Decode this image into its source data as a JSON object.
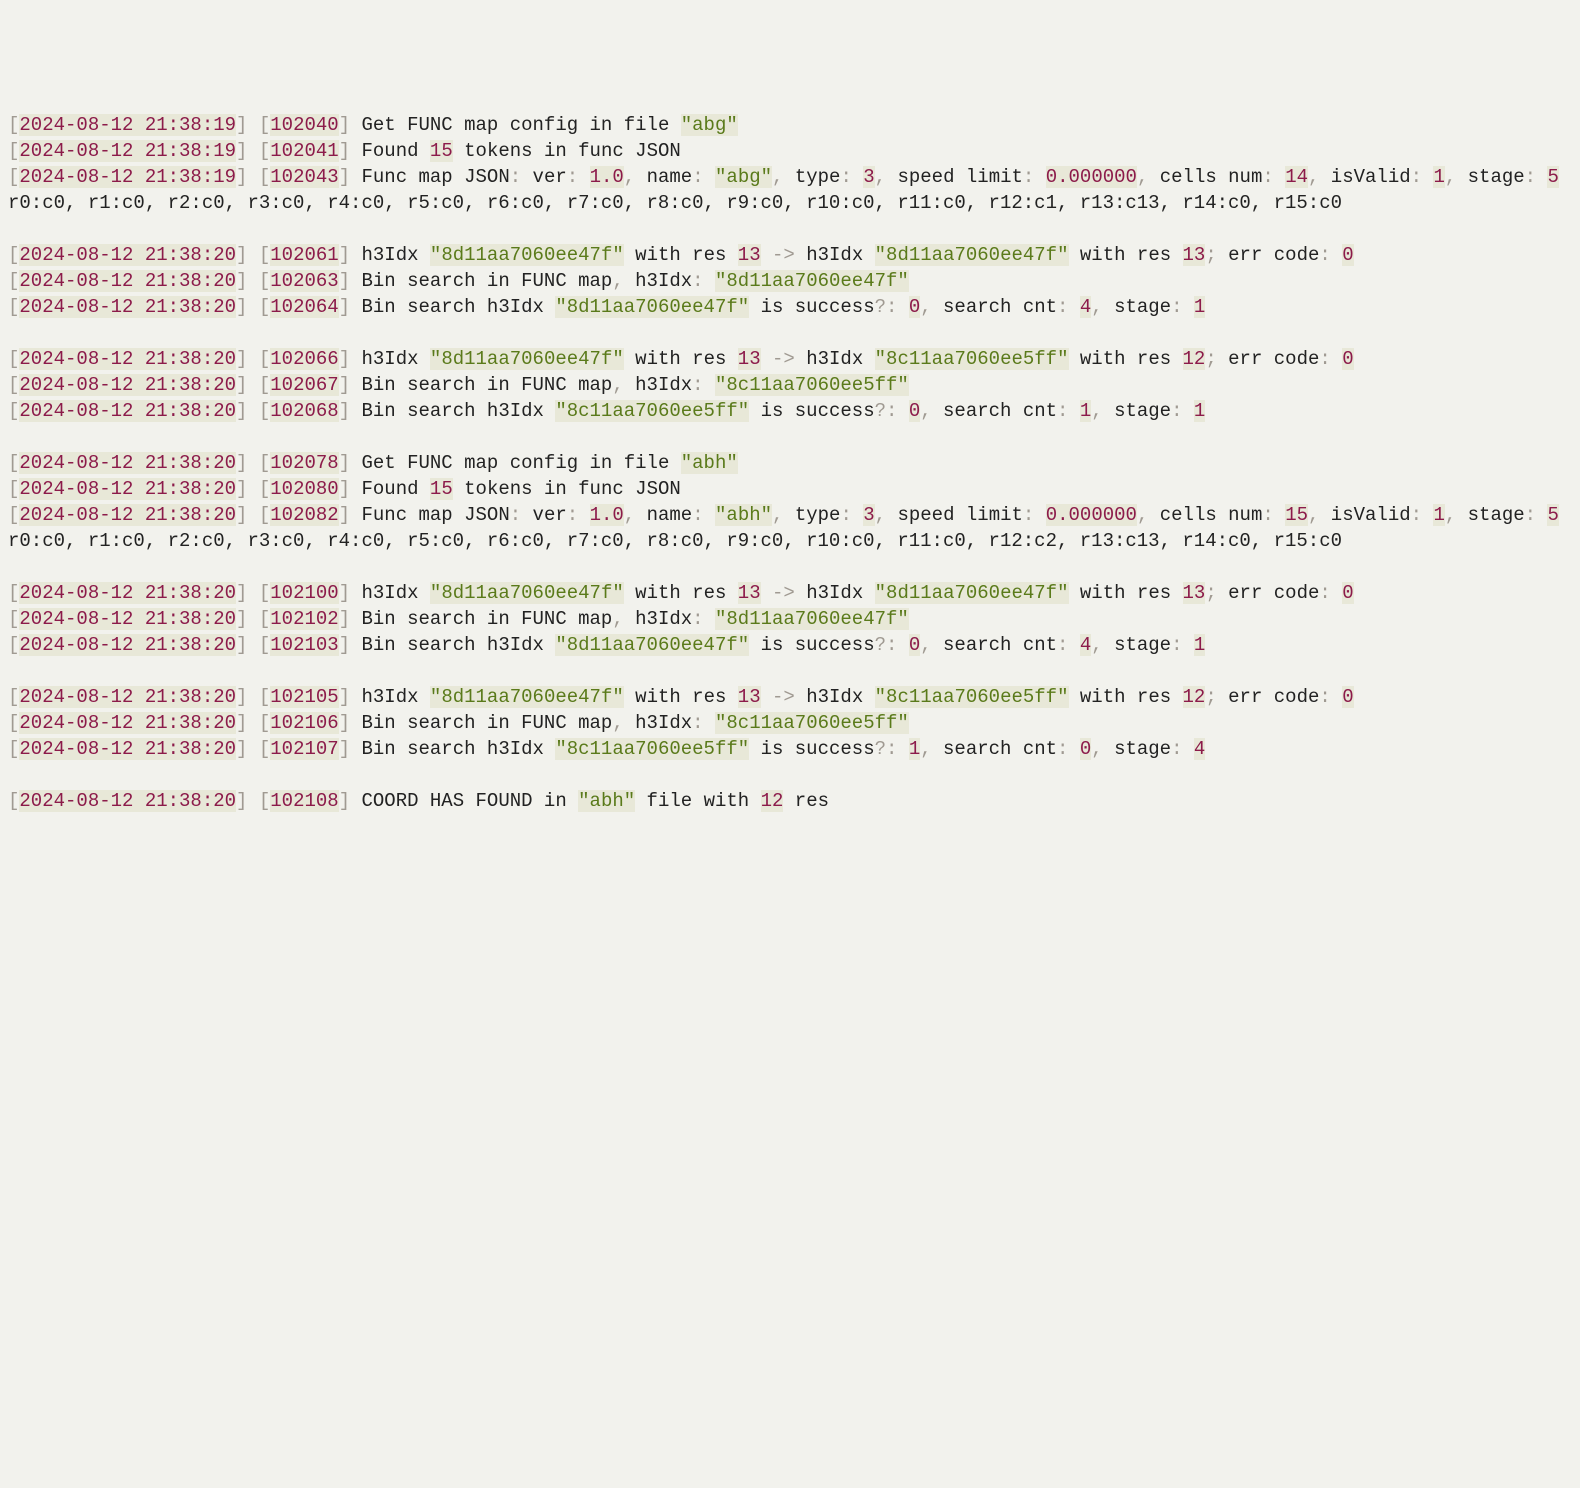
{
  "lines": [
    {
      "kind": "log",
      "ts": "2024-08-12 21:38:19",
      "id": "102040",
      "segs": [
        {
          "t": " Get FUNC map config in file "
        },
        {
          "t": "\"abg\"",
          "cls": "str hi"
        }
      ]
    },
    {
      "kind": "log",
      "ts": "2024-08-12 21:38:19",
      "id": "102041",
      "segs": [
        {
          "t": " Found "
        },
        {
          "t": "15",
          "cls": "num hi"
        },
        {
          "t": " tokens in func JSON"
        }
      ]
    },
    {
      "kind": "log",
      "ts": "2024-08-12 21:38:19",
      "id": "102043",
      "segs": [
        {
          "t": " Func map JSON"
        },
        {
          "t": ":",
          "cls": "punct"
        },
        {
          "t": " ver"
        },
        {
          "t": ":",
          "cls": "punct"
        },
        {
          "t": " "
        },
        {
          "t": "1.0",
          "cls": "num hi"
        },
        {
          "t": ",",
          "cls": "punct"
        },
        {
          "t": " name"
        },
        {
          "t": ":",
          "cls": "punct"
        },
        {
          "t": " "
        },
        {
          "t": "\"abg\"",
          "cls": "str hi"
        },
        {
          "t": ",",
          "cls": "punct"
        },
        {
          "t": " type"
        },
        {
          "t": ":",
          "cls": "punct"
        },
        {
          "t": " "
        },
        {
          "t": "3",
          "cls": "num hi"
        },
        {
          "t": ",",
          "cls": "punct"
        },
        {
          "t": " speed limit"
        },
        {
          "t": ":",
          "cls": "punct"
        },
        {
          "t": " "
        },
        {
          "t": "0.000000",
          "cls": "num hi"
        },
        {
          "t": ",",
          "cls": "punct"
        },
        {
          "t": " cells num"
        },
        {
          "t": ":",
          "cls": "punct"
        },
        {
          "t": " "
        },
        {
          "t": "14",
          "cls": "num hi"
        },
        {
          "t": ",",
          "cls": "punct"
        },
        {
          "t": " isValid"
        },
        {
          "t": ":",
          "cls": "punct"
        },
        {
          "t": " "
        },
        {
          "t": "1",
          "cls": "num hi"
        },
        {
          "t": ",",
          "cls": "punct"
        },
        {
          "t": " stage"
        },
        {
          "t": ":",
          "cls": "punct"
        },
        {
          "t": " "
        },
        {
          "t": "5",
          "cls": "num hi"
        }
      ]
    },
    {
      "kind": "plain",
      "text": "r0:c0, r1:c0, r2:c0, r3:c0, r4:c0, r5:c0, r6:c0, r7:c0, r8:c0, r9:c0, r10:c0, r11:c0, r12:c1, r13:c13, r14:c0, r15:c0"
    },
    {
      "kind": "blank"
    },
    {
      "kind": "log",
      "ts": "2024-08-12 21:38:20",
      "id": "102061",
      "segs": [
        {
          "t": " h3Idx "
        },
        {
          "t": "\"8d11aa7060ee47f\"",
          "cls": "str hi"
        },
        {
          "t": " with res "
        },
        {
          "t": "13",
          "cls": "num hi"
        },
        {
          "t": " "
        },
        {
          "t": "->",
          "cls": "arrow"
        },
        {
          "t": " h3Idx "
        },
        {
          "t": "\"8d11aa7060ee47f\"",
          "cls": "str hi"
        },
        {
          "t": " with res "
        },
        {
          "t": "13",
          "cls": "num hi"
        },
        {
          "t": ";",
          "cls": "punct"
        },
        {
          "t": " err code"
        },
        {
          "t": ":",
          "cls": "punct"
        },
        {
          "t": " "
        },
        {
          "t": "0",
          "cls": "num hi"
        }
      ]
    },
    {
      "kind": "log",
      "ts": "2024-08-12 21:38:20",
      "id": "102063",
      "segs": [
        {
          "t": " Bin search in FUNC map"
        },
        {
          "t": ",",
          "cls": "punct"
        },
        {
          "t": " h3Idx"
        },
        {
          "t": ":",
          "cls": "punct"
        },
        {
          "t": " "
        },
        {
          "t": "\"8d11aa7060ee47f\"",
          "cls": "str hi"
        }
      ]
    },
    {
      "kind": "log",
      "ts": "2024-08-12 21:38:20",
      "id": "102064",
      "segs": [
        {
          "t": " Bin search h3Idx "
        },
        {
          "t": "\"8d11aa7060ee47f\"",
          "cls": "str hi"
        },
        {
          "t": " is success"
        },
        {
          "t": "?:",
          "cls": "punct"
        },
        {
          "t": " "
        },
        {
          "t": "0",
          "cls": "num hi"
        },
        {
          "t": ",",
          "cls": "punct"
        },
        {
          "t": " search cnt"
        },
        {
          "t": ":",
          "cls": "punct"
        },
        {
          "t": " "
        },
        {
          "t": "4",
          "cls": "num hi"
        },
        {
          "t": ",",
          "cls": "punct"
        },
        {
          "t": " stage"
        },
        {
          "t": ":",
          "cls": "punct"
        },
        {
          "t": " "
        },
        {
          "t": "1",
          "cls": "num hi"
        }
      ]
    },
    {
      "kind": "blank"
    },
    {
      "kind": "log",
      "ts": "2024-08-12 21:38:20",
      "id": "102066",
      "segs": [
        {
          "t": " h3Idx "
        },
        {
          "t": "\"8d11aa7060ee47f\"",
          "cls": "str hi"
        },
        {
          "t": " with res "
        },
        {
          "t": "13",
          "cls": "num hi"
        },
        {
          "t": " "
        },
        {
          "t": "->",
          "cls": "arrow"
        },
        {
          "t": " h3Idx "
        },
        {
          "t": "\"8c11aa7060ee5ff\"",
          "cls": "str hi"
        },
        {
          "t": " with res "
        },
        {
          "t": "12",
          "cls": "num hi"
        },
        {
          "t": ";",
          "cls": "punct"
        },
        {
          "t": " err code"
        },
        {
          "t": ":",
          "cls": "punct"
        },
        {
          "t": " "
        },
        {
          "t": "0",
          "cls": "num hi"
        }
      ]
    },
    {
      "kind": "log",
      "ts": "2024-08-12 21:38:20",
      "id": "102067",
      "segs": [
        {
          "t": " Bin search in FUNC map"
        },
        {
          "t": ",",
          "cls": "punct"
        },
        {
          "t": " h3Idx"
        },
        {
          "t": ":",
          "cls": "punct"
        },
        {
          "t": " "
        },
        {
          "t": "\"8c11aa7060ee5ff\"",
          "cls": "str hi"
        }
      ]
    },
    {
      "kind": "log",
      "ts": "2024-08-12 21:38:20",
      "id": "102068",
      "segs": [
        {
          "t": " Bin search h3Idx "
        },
        {
          "t": "\"8c11aa7060ee5ff\"",
          "cls": "str hi"
        },
        {
          "t": " is success"
        },
        {
          "t": "?:",
          "cls": "punct"
        },
        {
          "t": " "
        },
        {
          "t": "0",
          "cls": "num hi"
        },
        {
          "t": ",",
          "cls": "punct"
        },
        {
          "t": " search cnt"
        },
        {
          "t": ":",
          "cls": "punct"
        },
        {
          "t": " "
        },
        {
          "t": "1",
          "cls": "num hi"
        },
        {
          "t": ",",
          "cls": "punct"
        },
        {
          "t": " stage"
        },
        {
          "t": ":",
          "cls": "punct"
        },
        {
          "t": " "
        },
        {
          "t": "1",
          "cls": "num hi"
        }
      ]
    },
    {
      "kind": "blank"
    },
    {
      "kind": "log",
      "ts": "2024-08-12 21:38:20",
      "id": "102078",
      "segs": [
        {
          "t": " Get FUNC map config in file "
        },
        {
          "t": "\"abh\"",
          "cls": "str hi"
        }
      ]
    },
    {
      "kind": "log",
      "ts": "2024-08-12 21:38:20",
      "id": "102080",
      "segs": [
        {
          "t": " Found "
        },
        {
          "t": "15",
          "cls": "num hi"
        },
        {
          "t": " tokens in func JSON"
        }
      ]
    },
    {
      "kind": "log",
      "ts": "2024-08-12 21:38:20",
      "id": "102082",
      "segs": [
        {
          "t": " Func map JSON"
        },
        {
          "t": ":",
          "cls": "punct"
        },
        {
          "t": " ver"
        },
        {
          "t": ":",
          "cls": "punct"
        },
        {
          "t": " "
        },
        {
          "t": "1.0",
          "cls": "num hi"
        },
        {
          "t": ",",
          "cls": "punct"
        },
        {
          "t": " name"
        },
        {
          "t": ":",
          "cls": "punct"
        },
        {
          "t": " "
        },
        {
          "t": "\"abh\"",
          "cls": "str hi"
        },
        {
          "t": ",",
          "cls": "punct"
        },
        {
          "t": " type"
        },
        {
          "t": ":",
          "cls": "punct"
        },
        {
          "t": " "
        },
        {
          "t": "3",
          "cls": "num hi"
        },
        {
          "t": ",",
          "cls": "punct"
        },
        {
          "t": " speed limit"
        },
        {
          "t": ":",
          "cls": "punct"
        },
        {
          "t": " "
        },
        {
          "t": "0.000000",
          "cls": "num hi"
        },
        {
          "t": ",",
          "cls": "punct"
        },
        {
          "t": " cells num"
        },
        {
          "t": ":",
          "cls": "punct"
        },
        {
          "t": " "
        },
        {
          "t": "15",
          "cls": "num hi"
        },
        {
          "t": ",",
          "cls": "punct"
        },
        {
          "t": " isValid"
        },
        {
          "t": ":",
          "cls": "punct"
        },
        {
          "t": " "
        },
        {
          "t": "1",
          "cls": "num hi"
        },
        {
          "t": ",",
          "cls": "punct"
        },
        {
          "t": " stage"
        },
        {
          "t": ":",
          "cls": "punct"
        },
        {
          "t": " "
        },
        {
          "t": "5",
          "cls": "num hi"
        }
      ]
    },
    {
      "kind": "plain",
      "text": "r0:c0, r1:c0, r2:c0, r3:c0, r4:c0, r5:c0, r6:c0, r7:c0, r8:c0, r9:c0, r10:c0, r11:c0, r12:c2, r13:c13, r14:c0, r15:c0"
    },
    {
      "kind": "blank"
    },
    {
      "kind": "log",
      "ts": "2024-08-12 21:38:20",
      "id": "102100",
      "segs": [
        {
          "t": " h3Idx "
        },
        {
          "t": "\"8d11aa7060ee47f\"",
          "cls": "str hi"
        },
        {
          "t": " with res "
        },
        {
          "t": "13",
          "cls": "num hi"
        },
        {
          "t": " "
        },
        {
          "t": "->",
          "cls": "arrow"
        },
        {
          "t": " h3Idx "
        },
        {
          "t": "\"8d11aa7060ee47f\"",
          "cls": "str hi"
        },
        {
          "t": " with res "
        },
        {
          "t": "13",
          "cls": "num hi"
        },
        {
          "t": ";",
          "cls": "punct"
        },
        {
          "t": " err code"
        },
        {
          "t": ":",
          "cls": "punct"
        },
        {
          "t": " "
        },
        {
          "t": "0",
          "cls": "num hi"
        }
      ]
    },
    {
      "kind": "log",
      "ts": "2024-08-12 21:38:20",
      "id": "102102",
      "segs": [
        {
          "t": " Bin search in FUNC map"
        },
        {
          "t": ",",
          "cls": "punct"
        },
        {
          "t": " h3Idx"
        },
        {
          "t": ":",
          "cls": "punct"
        },
        {
          "t": " "
        },
        {
          "t": "\"8d11aa7060ee47f\"",
          "cls": "str hi"
        }
      ]
    },
    {
      "kind": "log",
      "ts": "2024-08-12 21:38:20",
      "id": "102103",
      "segs": [
        {
          "t": " Bin search h3Idx "
        },
        {
          "t": "\"8d11aa7060ee47f\"",
          "cls": "str hi"
        },
        {
          "t": " is success"
        },
        {
          "t": "?:",
          "cls": "punct"
        },
        {
          "t": " "
        },
        {
          "t": "0",
          "cls": "num hi"
        },
        {
          "t": ",",
          "cls": "punct"
        },
        {
          "t": " search cnt"
        },
        {
          "t": ":",
          "cls": "punct"
        },
        {
          "t": " "
        },
        {
          "t": "4",
          "cls": "num hi"
        },
        {
          "t": ",",
          "cls": "punct"
        },
        {
          "t": " stage"
        },
        {
          "t": ":",
          "cls": "punct"
        },
        {
          "t": " "
        },
        {
          "t": "1",
          "cls": "num hi"
        }
      ]
    },
    {
      "kind": "blank"
    },
    {
      "kind": "log",
      "ts": "2024-08-12 21:38:20",
      "id": "102105",
      "segs": [
        {
          "t": " h3Idx "
        },
        {
          "t": "\"8d11aa7060ee47f\"",
          "cls": "str hi"
        },
        {
          "t": " with res "
        },
        {
          "t": "13",
          "cls": "num hi"
        },
        {
          "t": " "
        },
        {
          "t": "->",
          "cls": "arrow"
        },
        {
          "t": " h3Idx "
        },
        {
          "t": "\"8c11aa7060ee5ff\"",
          "cls": "str hi"
        },
        {
          "t": " with res "
        },
        {
          "t": "12",
          "cls": "num hi"
        },
        {
          "t": ";",
          "cls": "punct"
        },
        {
          "t": " err code"
        },
        {
          "t": ":",
          "cls": "punct"
        },
        {
          "t": " "
        },
        {
          "t": "0",
          "cls": "num hi"
        }
      ]
    },
    {
      "kind": "log",
      "ts": "2024-08-12 21:38:20",
      "id": "102106",
      "segs": [
        {
          "t": " Bin search in FUNC map"
        },
        {
          "t": ",",
          "cls": "punct"
        },
        {
          "t": " h3Idx"
        },
        {
          "t": ":",
          "cls": "punct"
        },
        {
          "t": " "
        },
        {
          "t": "\"8c11aa7060ee5ff\"",
          "cls": "str hi"
        }
      ]
    },
    {
      "kind": "log",
      "ts": "2024-08-12 21:38:20",
      "id": "102107",
      "segs": [
        {
          "t": " Bin search h3Idx "
        },
        {
          "t": "\"8c11aa7060ee5ff\"",
          "cls": "str hi"
        },
        {
          "t": " is success"
        },
        {
          "t": "?:",
          "cls": "punct"
        },
        {
          "t": " "
        },
        {
          "t": "1",
          "cls": "num hi"
        },
        {
          "t": ",",
          "cls": "punct"
        },
        {
          "t": " search cnt"
        },
        {
          "t": ":",
          "cls": "punct"
        },
        {
          "t": " "
        },
        {
          "t": "0",
          "cls": "num hi"
        },
        {
          "t": ",",
          "cls": "punct"
        },
        {
          "t": " stage"
        },
        {
          "t": ":",
          "cls": "punct"
        },
        {
          "t": " "
        },
        {
          "t": "4",
          "cls": "num hi"
        }
      ]
    },
    {
      "kind": "blank"
    },
    {
      "kind": "log",
      "ts": "2024-08-12 21:38:20",
      "id": "102108",
      "segs": [
        {
          "t": " COORD HAS FOUND in "
        },
        {
          "t": "\"abh\"",
          "cls": "str hi"
        },
        {
          "t": " file with "
        },
        {
          "t": "12",
          "cls": "num hi"
        },
        {
          "t": " res"
        }
      ]
    }
  ]
}
